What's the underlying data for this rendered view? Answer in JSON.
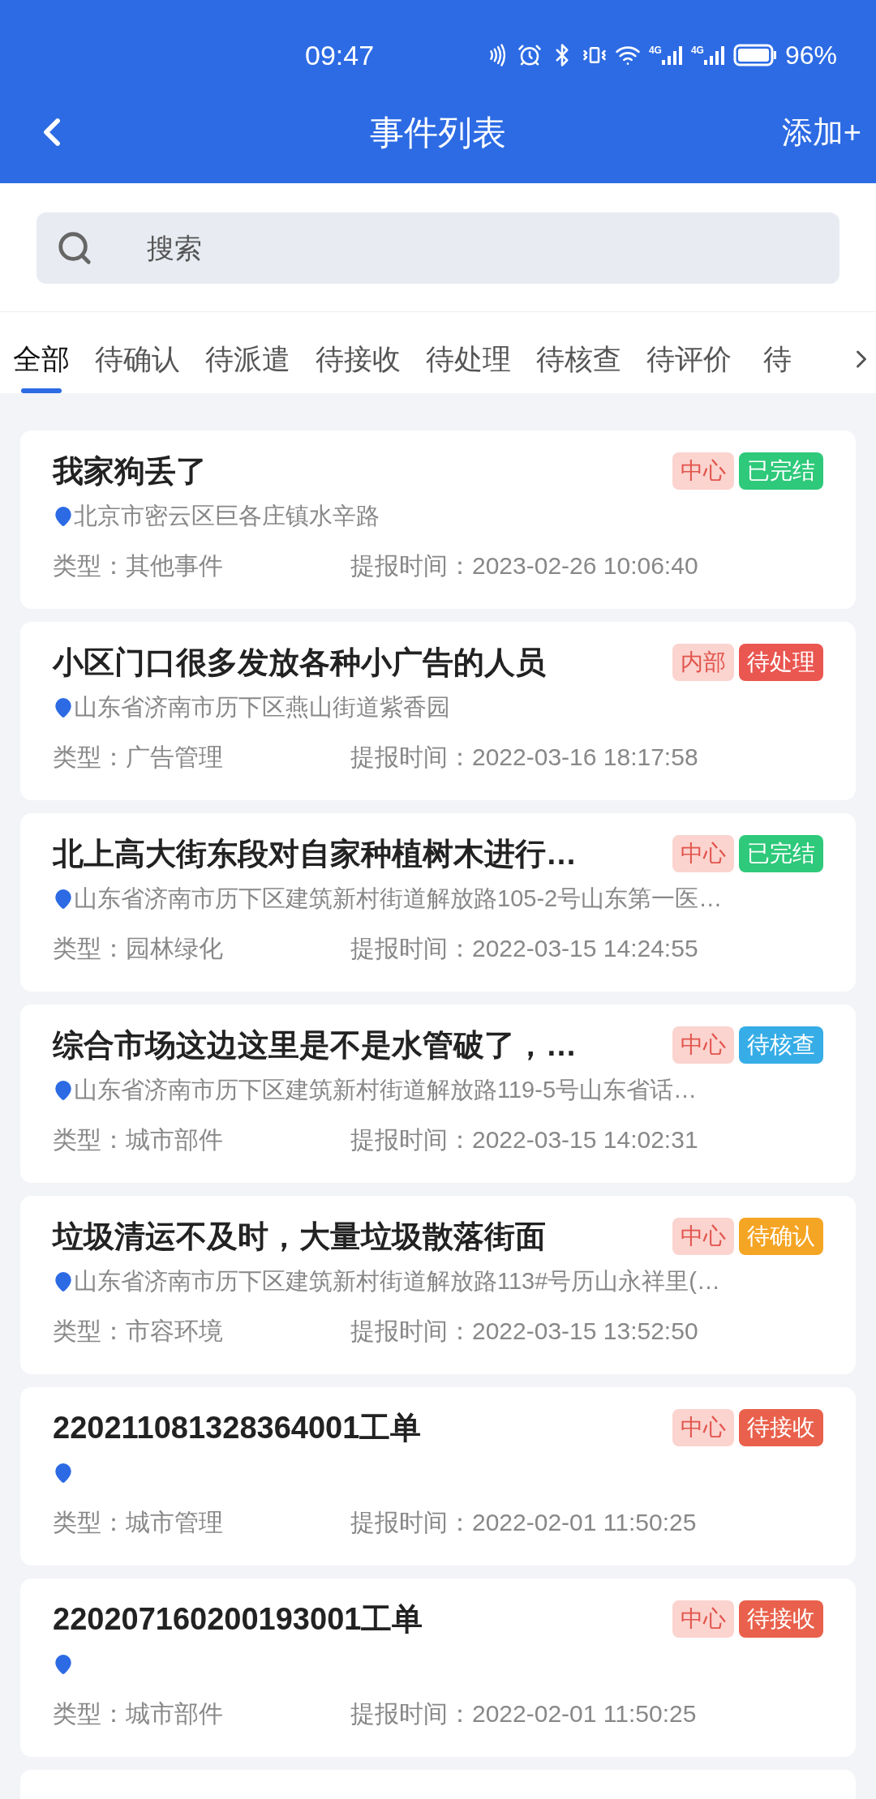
{
  "status_bar": {
    "time": "09:47",
    "network": [
      "4G",
      "4G"
    ],
    "battery": "96%"
  },
  "header": {
    "title": "事件列表",
    "action": "添加+"
  },
  "search": {
    "placeholder": "搜索"
  },
  "tabs": [
    {
      "label": "全部",
      "selected": true
    },
    {
      "label": "待确认",
      "selected": false
    },
    {
      "label": "待派遣",
      "selected": false
    },
    {
      "label": "待接收",
      "selected": false
    },
    {
      "label": "待处理",
      "selected": false
    },
    {
      "label": "待核查",
      "selected": false
    },
    {
      "label": "待评价",
      "selected": false
    },
    {
      "label": "待",
      "selected": false
    }
  ],
  "events": [
    {
      "title": "我家狗丢了",
      "source": "中心",
      "status": {
        "label": "已完结",
        "color": "#2ec97a"
      },
      "address": "北京市密云区巨各庄镇水辛路",
      "type_label": "类型：",
      "type": "其他事件",
      "time_label": "提报时间：",
      "time": "2023-02-26 10:06:40"
    },
    {
      "title": "小区门口很多发放各种小广告的人员",
      "source": "内部",
      "status": {
        "label": "待处理",
        "color": "#ea5650"
      },
      "address": "山东省济南市历下区燕山街道紫香园",
      "type_label": "类型：",
      "type": "广告管理",
      "time_label": "提报时间：",
      "time": "2022-03-16 18:17:58"
    },
    {
      "title": "北上高大街东段对自家种植树木进行…",
      "source": "中心",
      "status": {
        "label": "已完结",
        "color": "#2ec97a"
      },
      "address": "山东省济南市历下区建筑新村街道解放路105-2号山东第一医…",
      "type_label": "类型：",
      "type": "园林绿化",
      "time_label": "提报时间：",
      "time": "2022-03-15 14:24:55"
    },
    {
      "title": "综合市场这边这里是不是水管破了，…",
      "source": "中心",
      "status": {
        "label": "待核查",
        "color": "#36ade6"
      },
      "address": "山东省济南市历下区建筑新村街道解放路119-5号山东省话…",
      "type_label": "类型：",
      "type": "城市部件",
      "time_label": "提报时间：",
      "time": "2022-03-15 14:02:31"
    },
    {
      "title": "垃圾清运不及时，大量垃圾散落街面",
      "source": "中心",
      "status": {
        "label": "待确认",
        "color": "#f5a524"
      },
      "address": "山东省济南市历下区建筑新村街道解放路113#号历山永祥里(…",
      "type_label": "类型：",
      "type": "市容环境",
      "time_label": "提报时间：",
      "time": "2022-03-15 13:52:50"
    },
    {
      "title": "220211081328364001工单",
      "source": "中心",
      "status": {
        "label": "待接收",
        "color": "#e9614c"
      },
      "type_label": "类型：",
      "type": "城市管理",
      "time_label": "提报时间：",
      "time": "2022-02-01 11:50:25"
    },
    {
      "title": "220207160200193001工单",
      "source": "中心",
      "status": {
        "label": "待接收",
        "color": "#e9614c"
      },
      "type_label": "类型：",
      "type": "城市部件",
      "time_label": "提报时间：",
      "time": "2022-02-01 11:50:25"
    }
  ]
}
